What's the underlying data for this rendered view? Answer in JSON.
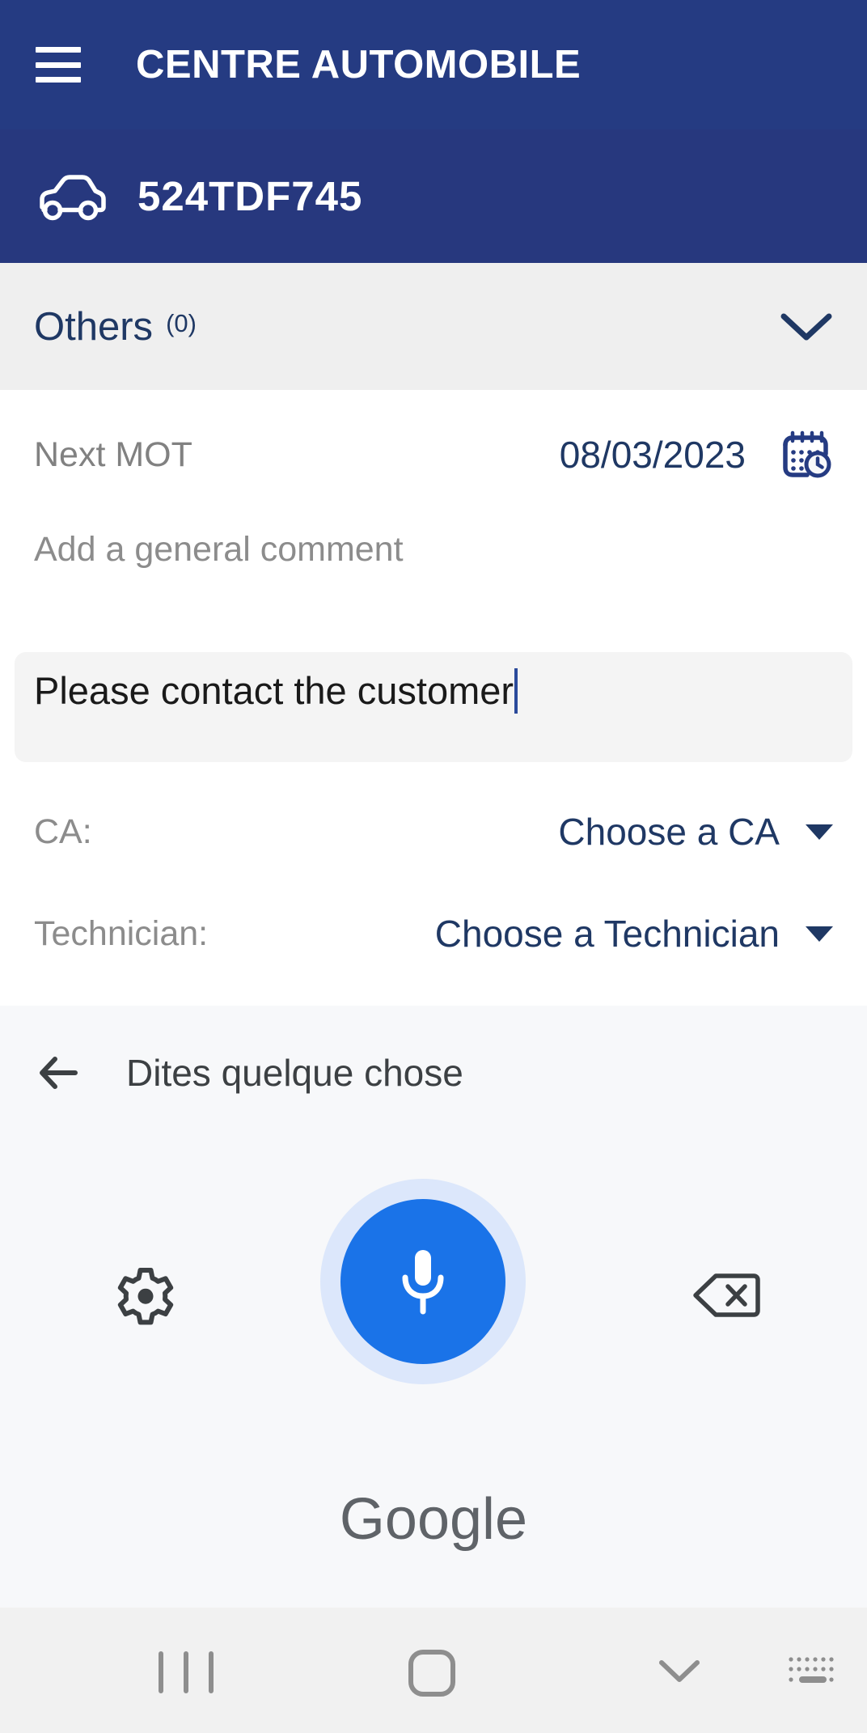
{
  "appbar": {
    "menu_icon": "hamburger-menu-icon",
    "title": "CENTRE AUTOMOBILE"
  },
  "plate_bar": {
    "vehicle_icon": "car-icon",
    "plate": "524TDF745"
  },
  "accordion": {
    "title": "Others",
    "count": "(0)",
    "expand_icon": "chevron-down-icon"
  },
  "form": {
    "mot": {
      "label": "Next MOT",
      "date": "08/03/2023",
      "icon": "calendar-clock-icon"
    },
    "comment": {
      "label": "Add a general comment",
      "value": "Please contact the customer",
      "placeholder": "Add a general comment"
    },
    "ca": {
      "label": "CA:",
      "value": "Choose a CA",
      "dropdown_icon": "caret-down-icon"
    },
    "technician": {
      "label": "Technician:",
      "value": "Choose a Technician",
      "dropdown_icon": "caret-down-icon"
    }
  },
  "voice_panel": {
    "back_icon": "arrow-left-icon",
    "title": "Dites quelque chose",
    "settings_icon": "gear-icon",
    "mic_icon": "microphone-icon",
    "backspace_icon": "backspace-delete-icon",
    "brand": "Google"
  },
  "navbar": {
    "recents_icon": "recents-icon",
    "home_icon": "home-icon",
    "hide_keyboard_icon": "chevron-down-icon",
    "keyboard_switch_icon": "keyboard-icon"
  },
  "colors": {
    "appbar_bg": "#253B82",
    "plate_bar_bg": "#27387E",
    "accordion_bg": "#EFEFEF",
    "accent_navy": "#1F3864",
    "mic_blue": "#1A73E8",
    "mic_halo": "#DCE7FB",
    "voice_panel_bg": "#F7F8FA",
    "navbar_bg": "#F1F1F1",
    "comment_bg": "#F4F4F4"
  }
}
